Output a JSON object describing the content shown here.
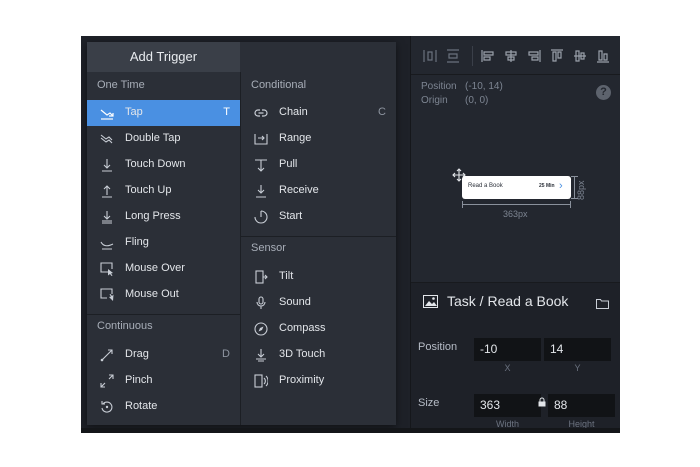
{
  "menu": {
    "add_trigger_label": "Add Trigger",
    "one_time": {
      "title": "One Time",
      "items": [
        {
          "label": "Tap",
          "shortcut": "T",
          "icon": "tap-icon",
          "selected": true
        },
        {
          "label": "Double Tap",
          "shortcut": "",
          "icon": "double-tap-icon"
        },
        {
          "label": "Touch Down",
          "shortcut": "",
          "icon": "touch-down-icon"
        },
        {
          "label": "Touch Up",
          "shortcut": "",
          "icon": "touch-up-icon"
        },
        {
          "label": "Long Press",
          "shortcut": "",
          "icon": "long-press-icon"
        },
        {
          "label": "Fling",
          "shortcut": "",
          "icon": "fling-icon"
        },
        {
          "label": "Mouse Over",
          "shortcut": "",
          "icon": "mouse-over-icon"
        },
        {
          "label": "Mouse Out",
          "shortcut": "",
          "icon": "mouse-out-icon"
        }
      ]
    },
    "continuous": {
      "title": "Continuous",
      "items": [
        {
          "label": "Drag",
          "shortcut": "D",
          "icon": "drag-icon"
        },
        {
          "label": "Pinch",
          "shortcut": "",
          "icon": "pinch-icon"
        },
        {
          "label": "Rotate",
          "shortcut": "",
          "icon": "rotate-icon"
        }
      ]
    },
    "conditional": {
      "title": "Conditional",
      "items": [
        {
          "label": "Chain",
          "shortcut": "C",
          "icon": "chain-icon"
        },
        {
          "label": "Range",
          "shortcut": "",
          "icon": "range-icon"
        },
        {
          "label": "Pull",
          "shortcut": "",
          "icon": "pull-icon"
        },
        {
          "label": "Receive",
          "shortcut": "",
          "icon": "receive-icon"
        },
        {
          "label": "Start",
          "shortcut": "",
          "icon": "start-icon"
        }
      ]
    },
    "sensor": {
      "title": "Sensor",
      "items": [
        {
          "label": "Tilt",
          "shortcut": "",
          "icon": "tilt-icon"
        },
        {
          "label": "Sound",
          "shortcut": "",
          "icon": "sound-icon"
        },
        {
          "label": "Compass",
          "shortcut": "",
          "icon": "compass-icon"
        },
        {
          "label": "3D Touch",
          "shortcut": "",
          "icon": "3d-touch-icon"
        },
        {
          "label": "Proximity",
          "shortcut": "",
          "icon": "proximity-icon"
        }
      ]
    }
  },
  "canvas": {
    "position_label": "Position",
    "position_value": "(-10, 14)",
    "origin_label": "Origin",
    "origin_value": "(0, 0)",
    "help_glyph": "?",
    "card_title": "Read a Book",
    "card_time": "25 Min",
    "card_chevron": "›",
    "width_label": "363px",
    "height_label": "88px"
  },
  "properties": {
    "title": "Task / Read a Book",
    "position_label": "Position",
    "x_value": "-10",
    "y_value": "14",
    "x_sub": "X",
    "y_sub": "Y",
    "size_label": "Size",
    "width_value": "363",
    "height_value": "88",
    "width_sub": "Width",
    "height_sub": "Height"
  },
  "colors": {
    "accent": "#4a90e2",
    "panel": "#2b2f37",
    "background": "#1e2128"
  }
}
